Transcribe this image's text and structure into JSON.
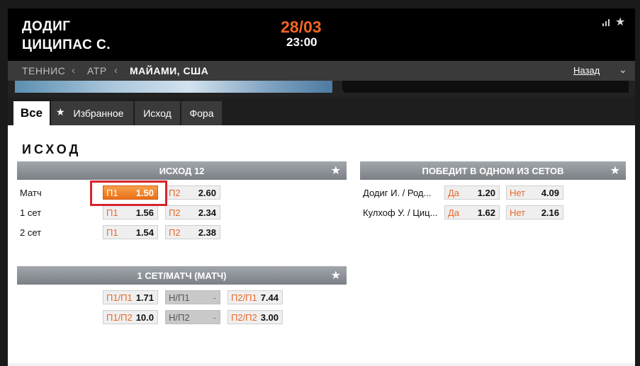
{
  "header": {
    "team1": "ДОДИГ",
    "team2": "ЦИЦИПАС С.",
    "date": "28/03",
    "time": "23:00"
  },
  "breadcrumbs": {
    "sport": "ТЕННИС",
    "tour": "ATP",
    "event": "МАЙАМИ, США",
    "back": "Назад"
  },
  "tabs": [
    "Все",
    "Избранное",
    "Исход",
    "Фора"
  ],
  "section_title": "ИСХОД",
  "markets": {
    "outcome12": {
      "title": "ИСХОД 12",
      "rows": [
        {
          "label": "Матч",
          "odds": [
            {
              "lbl": "П1",
              "val": "1.50"
            },
            {
              "lbl": "П2",
              "val": "2.60"
            }
          ]
        },
        {
          "label": "1 сет",
          "odds": [
            {
              "lbl": "П1",
              "val": "1.56"
            },
            {
              "lbl": "П2",
              "val": "2.34"
            }
          ]
        },
        {
          "label": "2 сет",
          "odds": [
            {
              "lbl": "П1",
              "val": "1.54"
            },
            {
              "lbl": "П2",
              "val": "2.38"
            }
          ]
        }
      ]
    },
    "win_one_set": {
      "title": "ПОБЕДИТ В ОДНОМ ИЗ СЕТОВ",
      "rows": [
        {
          "label": "Додиг И. / Род...",
          "odds": [
            {
              "lbl": "Да",
              "val": "1.20"
            },
            {
              "lbl": "Нет",
              "val": "4.09"
            }
          ]
        },
        {
          "label": "Кулхоф У. / Циц...",
          "odds": [
            {
              "lbl": "Да",
              "val": "1.62"
            },
            {
              "lbl": "Нет",
              "val": "2.16"
            }
          ]
        }
      ]
    },
    "set1_match": {
      "title": "1 СЕТ/МАТЧ (МАТЧ)",
      "rows": [
        {
          "odds": [
            {
              "lbl": "П1/П1",
              "val": "1.71"
            },
            {
              "lbl": "Н/П1",
              "val": "-"
            },
            {
              "lbl": "П2/П1",
              "val": "7.44"
            }
          ]
        },
        {
          "odds": [
            {
              "lbl": "П1/П2",
              "val": "10.0"
            },
            {
              "lbl": "Н/П2",
              "val": "-"
            },
            {
              "lbl": "П2/П2",
              "val": "3.00"
            }
          ]
        }
      ]
    }
  },
  "colors": {
    "accent": "#f26522",
    "selected_odd": "#ea6f16",
    "highlight_box": "#d6242b",
    "market_header": "#8a8f94"
  }
}
